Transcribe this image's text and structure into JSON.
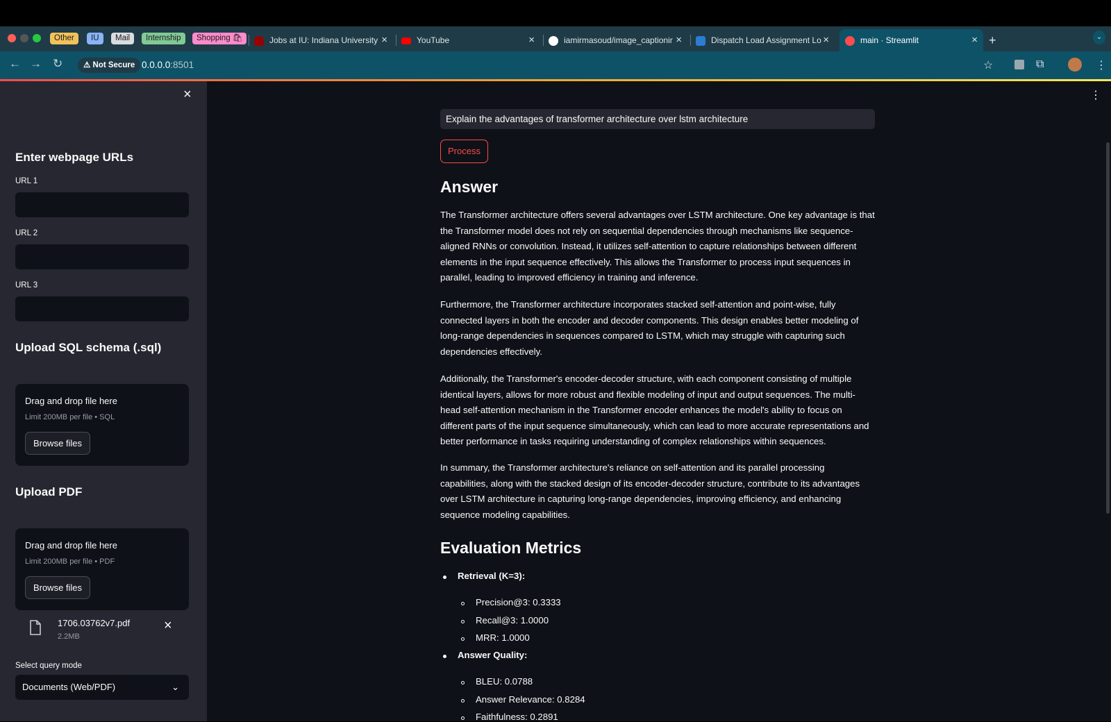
{
  "browser": {
    "tab_groups": [
      {
        "label": "Other",
        "color": "#f2c25a"
      },
      {
        "label": "IU",
        "color": "#8ab4f8"
      },
      {
        "label": "Mail",
        "color": "#dadce0"
      },
      {
        "label": "Internship",
        "color": "#81c995"
      },
      {
        "label": "Shopping 🛍",
        "color": "#ff8bcb"
      }
    ],
    "tabs": [
      {
        "title": "Jobs at IU: Indiana University",
        "icon": "iu-shield-icon"
      },
      {
        "title": "YouTube",
        "icon": "youtube-icon"
      },
      {
        "title": "iamirmasoud/image_captionir",
        "icon": "github-icon"
      },
      {
        "title": "Dispatch Load Assignment Lo",
        "icon": "word-icon"
      },
      {
        "title": "main · Streamlit",
        "icon": "streamlit-icon",
        "active": true
      }
    ],
    "security_label": "Not Secure",
    "url": "0.0.0.0:8501",
    "url_host": "0.0.0.0",
    "url_port": ":8501",
    "new_tab": "+"
  },
  "sidebar": {
    "urls_heading": "Enter webpage URLs",
    "url_fields": [
      {
        "label": "URL 1",
        "value": ""
      },
      {
        "label": "URL 2",
        "value": ""
      },
      {
        "label": "URL 3",
        "value": ""
      }
    ],
    "sql_heading": "Upload SQL schema (.sql)",
    "sql_uploader": {
      "title": "Drag and drop file here",
      "limit": "Limit 200MB per file • SQL",
      "button": "Browse files"
    },
    "pdf_heading": "Upload PDF",
    "pdf_uploader": {
      "title": "Drag and drop file here",
      "limit": "Limit 200MB per file • PDF",
      "button": "Browse files"
    },
    "uploaded_file": {
      "name": "1706.03762v7.pdf",
      "size": "2.2MB"
    },
    "mode_label": "Select query mode",
    "mode_value": "Documents (Web/PDF)"
  },
  "main": {
    "query": "Explain the advantages of transformer architecture over lstm architecture",
    "process_button": "Process",
    "answer_heading": "Answer",
    "answer_paragraphs": [
      "The Transformer architecture offers several advantages over LSTM architecture. One key advantage is that the Transformer model does not rely on sequential dependencies through mechanisms like sequence-aligned RNNs or convolution. Instead, it utilizes self-attention to capture relationships between different elements in the input sequence effectively. This allows the Transformer to process input sequences in parallel, leading to improved efficiency in training and inference.",
      "Furthermore, the Transformer architecture incorporates stacked self-attention and point-wise, fully connected layers in both the encoder and decoder components. This design enables better modeling of long-range dependencies in sequences compared to LSTM, which may struggle with capturing such dependencies effectively.",
      "Additionally, the Transformer's encoder-decoder structure, with each component consisting of multiple identical layers, allows for more robust and flexible modeling of input and output sequences. The multi-head self-attention mechanism in the Transformer encoder enhances the model's ability to focus on different parts of the input sequence simultaneously, which can lead to more accurate representations and better performance in tasks requiring understanding of complex relationships within sequences.",
      "In summary, the Transformer architecture's reliance on self-attention and its parallel processing capabilities, along with the stacked design of its encoder-decoder structure, contribute to its advantages over LSTM architecture in capturing long-range dependencies, improving efficiency, and enhancing sequence modeling capabilities."
    ],
    "metrics_heading": "Evaluation Metrics",
    "metrics": [
      {
        "title": "Retrieval (K=3):",
        "items": [
          "Precision@3: 0.3333",
          "Recall@3: 1.0000",
          "MRR: 1.0000"
        ]
      },
      {
        "title": "Answer Quality:",
        "items": [
          "BLEU: 0.0788",
          "Answer Relevance: 0.8284",
          "Faithfulness: 0.2891"
        ]
      }
    ]
  },
  "colors": {
    "primary": "#ff4b4b",
    "sidebar_bg": "#262730",
    "main_bg": "#0e1117"
  }
}
